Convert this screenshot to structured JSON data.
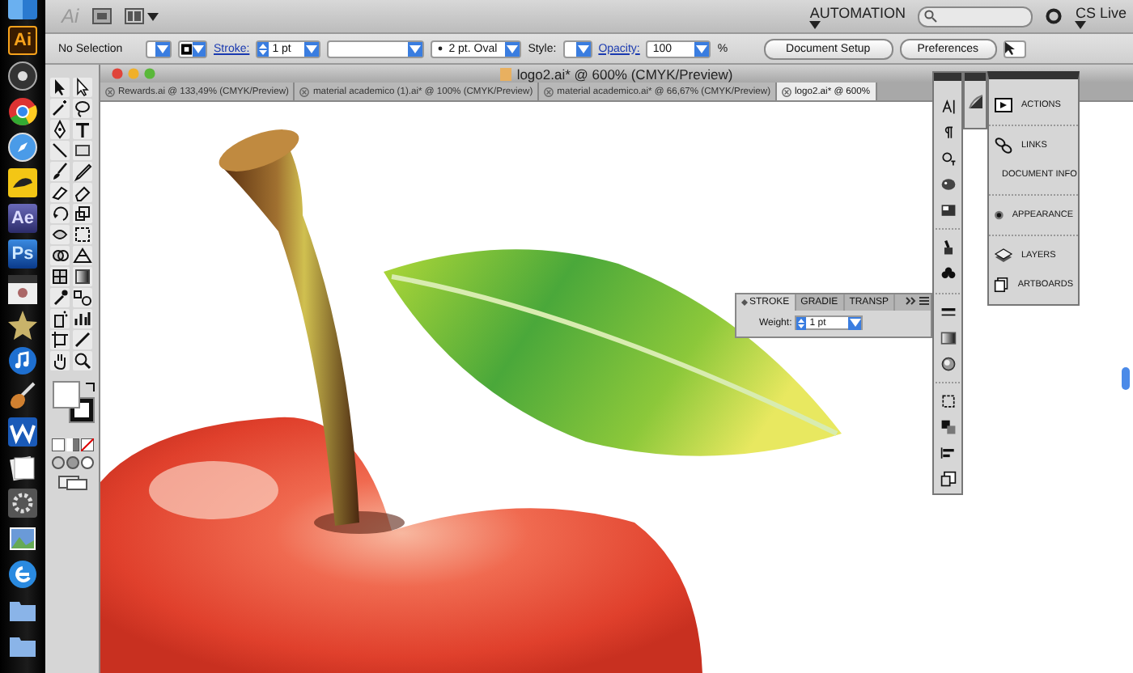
{
  "dock": [
    {
      "kind": "finder"
    },
    {
      "kind": "illustrator",
      "label": "Ai"
    },
    {
      "kind": "dashboard"
    },
    {
      "kind": "chrome"
    },
    {
      "kind": "safari"
    },
    {
      "kind": "bird"
    },
    {
      "kind": "aftereffects",
      "label": "Ae"
    },
    {
      "kind": "photoshop",
      "label": "Ps"
    },
    {
      "kind": "clapper"
    },
    {
      "kind": "star"
    },
    {
      "kind": "music"
    },
    {
      "kind": "guitar"
    },
    {
      "kind": "wave"
    },
    {
      "kind": "papers"
    },
    {
      "kind": "gear"
    },
    {
      "kind": "photos"
    },
    {
      "kind": "browser"
    },
    {
      "kind": "folder"
    },
    {
      "kind": "folder"
    }
  ],
  "app_bar": {
    "logo": "Ai",
    "workspace": "AUTOMATION",
    "cs_live": "CS Live"
  },
  "control_bar": {
    "selection": "No Selection",
    "stroke_label": "Stroke:",
    "stroke_weight": "1 pt",
    "brush": "2 pt. Oval",
    "style_label": "Style:",
    "opacity_label": "Opacity:",
    "opacity": "100",
    "percent": "%",
    "buttons": [
      "Document Setup",
      "Preferences"
    ]
  },
  "window": {
    "title": "logo2.ai* @ 600% (CMYK/Preview)"
  },
  "tabs": [
    {
      "label": "Rewards.ai @ 133,49% (CMYK/Preview)",
      "selected": false
    },
    {
      "label": "material academico (1).ai* @ 100% (CMYK/Preview)",
      "selected": false
    },
    {
      "label": "material academico.ai* @ 66,67% (CMYK/Preview)",
      "selected": false
    },
    {
      "label": "logo2.ai* @ 600%",
      "selected": true
    }
  ],
  "stroke_panel": {
    "tabs": [
      {
        "label": "STROKE",
        "selected": true
      },
      {
        "label": "GRADIE",
        "selected": false
      },
      {
        "label": "TRANSP",
        "selected": false
      }
    ],
    "weight_label": "Weight:",
    "weight": "1 pt"
  },
  "panel_menu": {
    "groups": [
      {
        "items": [
          {
            "kind": "actions",
            "label": "ACTIONS"
          }
        ]
      },
      {
        "items": [
          {
            "kind": "links",
            "label": "LINKS"
          },
          {
            "kind": "info",
            "label": "DOCUMENT INFO"
          }
        ]
      },
      {
        "items": [
          {
            "kind": "appearance",
            "label": "APPEARANCE"
          }
        ]
      },
      {
        "items": [
          {
            "kind": "layers",
            "label": "LAYERS"
          },
          {
            "kind": "artboards",
            "label": "ARTBOARDS"
          }
        ]
      }
    ]
  }
}
